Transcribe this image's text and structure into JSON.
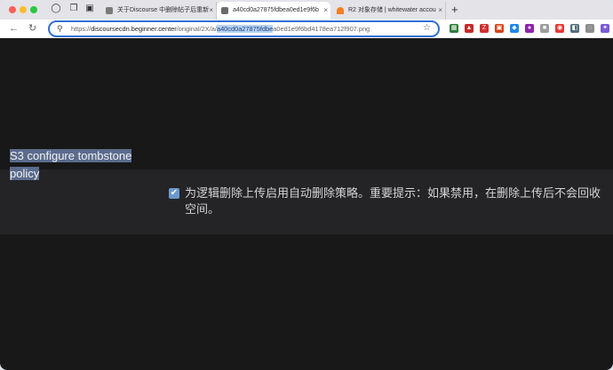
{
  "browser": {
    "tabs": [
      {
        "title": "关于Discourse 中删除帖子后重新",
        "active": false,
        "favicon_color": "#7a7a7a"
      },
      {
        "title": "a40cd0a27875fdbea0ed1e9f6b",
        "active": true,
        "favicon_color": "#6b6b6b"
      },
      {
        "title": "R2 对象存储 | whitewater accou",
        "active": false,
        "favicon_color": "#f38020"
      }
    ],
    "new_tab_label": "+",
    "tab_close_glyph": "×",
    "url_scheme": "https://",
    "url_host": "discoursecdn.beginner.center",
    "url_path": "/original/2X/a/",
    "url_selected": "a40cd0a27875fdbe",
    "url_rest": "a0ed1e9f6bd4178ea712f907.png",
    "extensions": [
      {
        "name": "extension-1",
        "color": "#2f7d3a",
        "glyph": "▦"
      },
      {
        "name": "extension-2",
        "color": "#c62828",
        "glyph": "▲"
      },
      {
        "name": "extension-3",
        "color": "#d32f2f",
        "glyph": "Z"
      },
      {
        "name": "extension-4",
        "color": "#d84315",
        "glyph": "▣"
      },
      {
        "name": "extension-5",
        "color": "#1e88e5",
        "glyph": "◆"
      },
      {
        "name": "extension-6",
        "color": "#8e24aa",
        "glyph": "●"
      },
      {
        "name": "extension-7",
        "color": "#9e9e9e",
        "glyph": "■"
      },
      {
        "name": "extension-8",
        "color": "#e53935",
        "glyph": "◉"
      },
      {
        "name": "extension-9",
        "color": "#546e7a",
        "glyph": "◧"
      },
      {
        "name": "extension-10",
        "color": "#8d8d8d",
        "glyph": "◌"
      },
      {
        "name": "extension-11",
        "color": "#7b5cd6",
        "glyph": "✦"
      }
    ]
  },
  "setting": {
    "label": "S3 configure tombstone policy",
    "checked": true,
    "description": "为逻辑删除上传启用自动删除策略。重要提示：如果禁用，在删除上传后不会回收空间。"
  }
}
